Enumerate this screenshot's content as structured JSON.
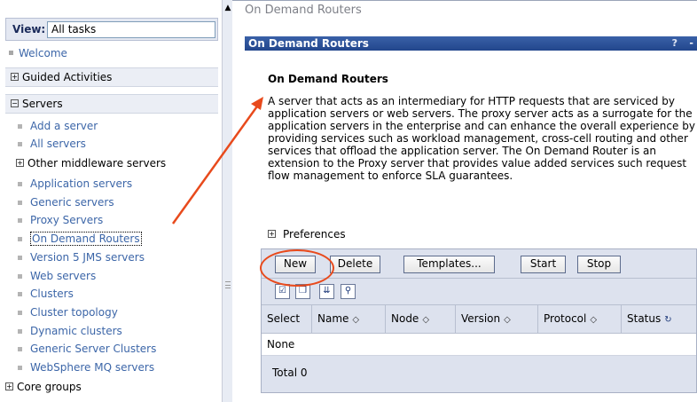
{
  "nav": {
    "view_label": "View:",
    "view_value": "All tasks",
    "welcome": "Welcome",
    "guided_activities": "Guided Activities",
    "servers": "Servers",
    "server_items": [
      "Add a server",
      "All servers",
      "Other middleware servers",
      "Application servers",
      "Generic servers",
      "Proxy Servers",
      "On Demand Routers",
      "Version 5 JMS servers",
      "Web servers",
      "Clusters",
      "Cluster topology",
      "Dynamic clusters",
      "Generic Server Clusters",
      "WebSphere MQ servers",
      "Core groups"
    ]
  },
  "breadcrumb": "On Demand Routers",
  "panel": {
    "bar_title": "On Demand Routers",
    "help": "?",
    "minimize": "-",
    "title": "On Demand Routers",
    "description": "A server that acts as an intermediary for HTTP requests that are serviced by application servers or web servers. The proxy server acts as a surrogate for the application servers in the enterprise and can enhance the overall experience by providing services such as workload management, cross-cell routing and other services that offload the application server. The On Demand Router is an extension to the Proxy server that provides value added services such request flow management to enforce SLA guarantees.",
    "preferences": "Preferences"
  },
  "toolbar": {
    "new": "New",
    "delete": "Delete",
    "templates": "Templates...",
    "start": "Start",
    "stop": "Stop"
  },
  "table": {
    "columns": [
      "Select",
      "Name",
      "Node",
      "Version",
      "Protocol",
      "Status"
    ],
    "empty_text": "None",
    "total": "Total 0"
  },
  "colors": {
    "accent": "#22468c",
    "link": "#3c66a8",
    "annotation": "#e84a1c"
  }
}
